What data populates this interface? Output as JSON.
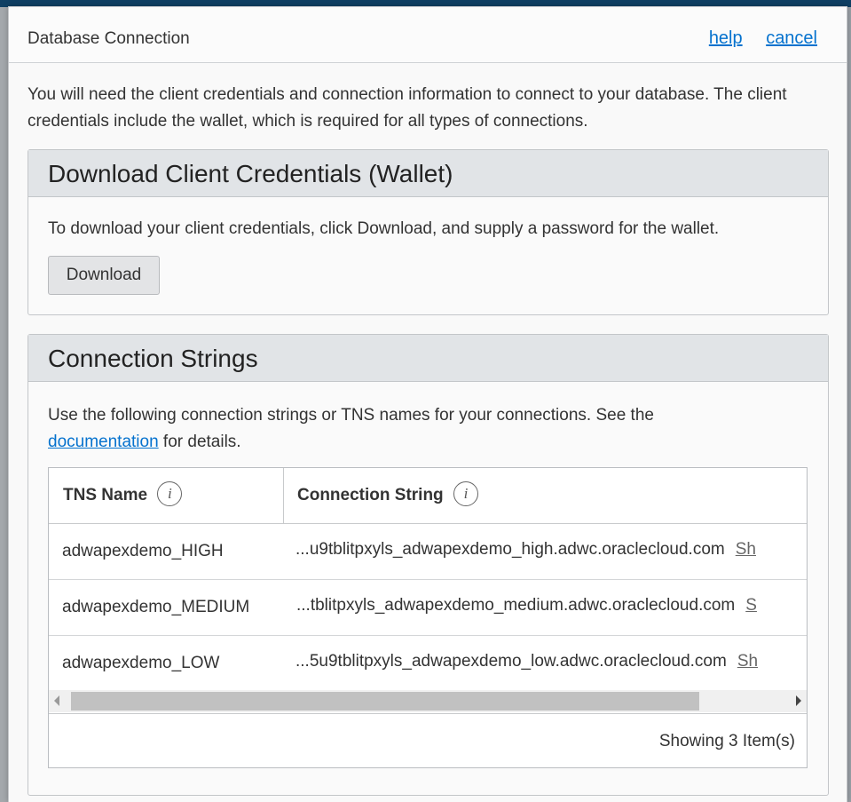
{
  "dialog": {
    "title": "Database Connection",
    "help_label": "help",
    "cancel_label": "cancel",
    "intro": "You will need the client credentials and connection information to connect to your database. The client credentials include the wallet, which is required for all types of connections."
  },
  "credentials": {
    "heading": "Download Client Credentials (Wallet)",
    "text": "To download your client credentials, click Download, and supply a password for the wallet.",
    "download_label": "Download"
  },
  "connections": {
    "heading": "Connection Strings",
    "text_before": "Use the following connection strings or TNS names for your connections. See the",
    "doc_link": "documentation",
    "text_after": " for details.",
    "table": {
      "col_tns": "TNS Name",
      "col_conn": "Connection String",
      "info_glyph": "i",
      "rows": [
        {
          "tns": "adwapexdemo_HIGH",
          "conn": "...u9tblitpxyls_adwapexdemo_high.adwc.oraclecloud.com",
          "show": "Sh"
        },
        {
          "tns": "adwapexdemo_MEDIUM",
          "conn": "...tblitpxyls_adwapexdemo_medium.adwc.oraclecloud.com",
          "show": "S"
        },
        {
          "tns": "adwapexdemo_LOW",
          "conn": "...5u9tblitpxyls_adwapexdemo_low.adwc.oraclecloud.com",
          "show": "Sh"
        }
      ],
      "footer": "Showing 3 Item(s)"
    }
  },
  "colors": {
    "link": "#0572ce",
    "panel_header": "#e1e4e7",
    "backdrop_bar": "#0f3f63"
  },
  "icons": {
    "info": "info-icon",
    "scroll_left": "scroll-left-arrow-icon",
    "scroll_right": "scroll-right-arrow-icon"
  }
}
